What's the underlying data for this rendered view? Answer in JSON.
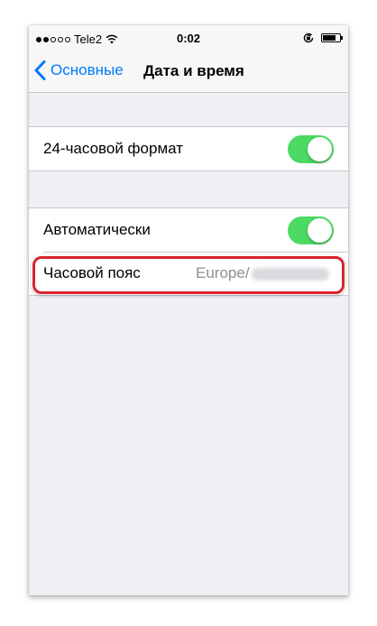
{
  "status_bar": {
    "signal_dots_filled": 2,
    "signal_dots_total": 5,
    "carrier": "Tele2",
    "time": "0:02",
    "battery_level": 0.8
  },
  "nav": {
    "back_label": "Основные",
    "title": "Дата и время"
  },
  "settings": {
    "format_24h": {
      "label": "24-часовой формат",
      "enabled": true
    },
    "automatic": {
      "label": "Автоматически",
      "enabled": true
    },
    "timezone": {
      "label": "Часовой пояс",
      "value": "Europe/"
    }
  },
  "colors": {
    "accent": "#007aff",
    "toggle_on": "#4cd964",
    "highlight": "#d9232d",
    "background": "#efeff4"
  },
  "icons": [
    "wifi-icon",
    "chevron-left-icon",
    "rotation-lock-icon",
    "battery-icon"
  ]
}
